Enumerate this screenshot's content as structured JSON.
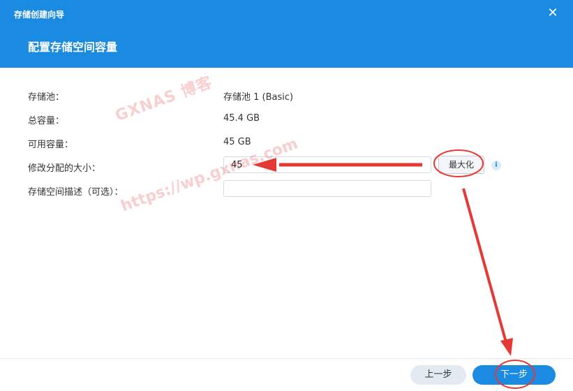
{
  "window": {
    "title": "存储创建向导",
    "close_symbol": "✕"
  },
  "step": {
    "title": "配置存储空间容量"
  },
  "form": {
    "pool": {
      "label": "存储池：",
      "value": "存储池 1 (Basic)"
    },
    "total": {
      "label": "总容量：",
      "value": "45.4 GB"
    },
    "available": {
      "label": "可用容量：",
      "value": "45 GB"
    },
    "size": {
      "label": "修改分配的大小：",
      "value": "45",
      "max_button": "最大化",
      "info_symbol": "i"
    },
    "desc": {
      "label": "存储空间描述（可选）：",
      "value": ""
    }
  },
  "footer": {
    "prev_label": "上一步",
    "next_label": "下一步"
  },
  "watermark": {
    "line1": "GXNAS 博客",
    "line2": "https://wp.gxnas.com"
  },
  "colors": {
    "accent": "#1a8be0",
    "annotation": "#e53935"
  },
  "icons": {
    "close": "close-icon",
    "info": "info-icon"
  }
}
